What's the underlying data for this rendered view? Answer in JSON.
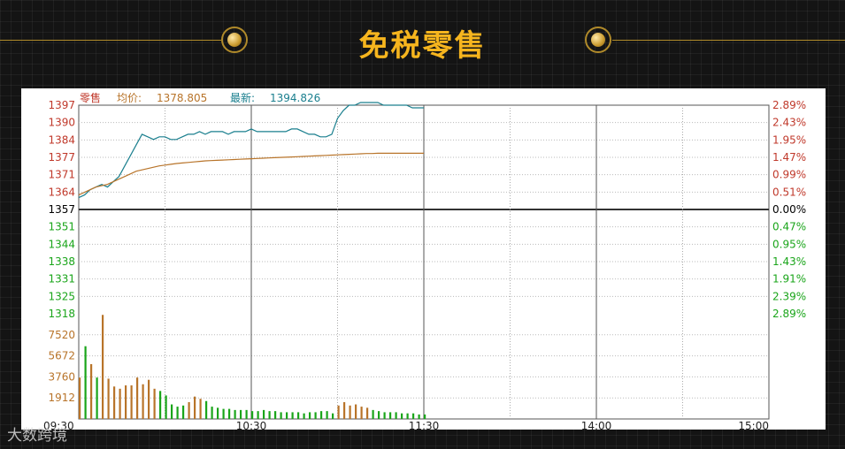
{
  "page": {
    "title": "免税零售",
    "watermark": "大数跨境"
  },
  "chart_data": {
    "type": "line",
    "header": {
      "name": "零售",
      "avg_label": "均价:",
      "avg_value": "1378.805",
      "last_label": "最新:",
      "last_value": "1394.826"
    },
    "price_axis": {
      "ylim": [
        1318,
        1397
      ],
      "base": 1357,
      "ticks_left": [
        "1397",
        "1390",
        "1384",
        "1377",
        "1371",
        "1364",
        "1357",
        "1351",
        "1344",
        "1338",
        "1331",
        "1325",
        "1318"
      ],
      "ticks_right": [
        "2.89%",
        "2.43%",
        "1.95%",
        "1.47%",
        "0.99%",
        "0.51%",
        "0.00%",
        "0.47%",
        "0.95%",
        "1.43%",
        "1.91%",
        "2.39%",
        "2.89%"
      ]
    },
    "volume_axis": {
      "ylim": [
        0,
        9400
      ],
      "ticks": [
        "7520",
        "5672",
        "3760",
        "1912"
      ]
    },
    "x_ticks": [
      "09:30",
      "10:30",
      "11:30",
      "14:00",
      "15:00"
    ],
    "total_minutes": 240,
    "colors": {
      "price": "#1a7f8e",
      "avg": "#b8742a",
      "up": "#c0392b",
      "down": "#1aa51a",
      "base": "#000000",
      "vol_up": "#b8742a",
      "vol_down": "#1aa51a"
    },
    "series": [
      {
        "name": "最新",
        "x": [
          0,
          2,
          4,
          6,
          8,
          10,
          12,
          14,
          16,
          18,
          20,
          22,
          24,
          26,
          28,
          30,
          32,
          34,
          36,
          38,
          40,
          42,
          44,
          46,
          48,
          50,
          52,
          54,
          56,
          58,
          60,
          62,
          64,
          66,
          68,
          70,
          72,
          74,
          76,
          78,
          80,
          82,
          84,
          86,
          88,
          90,
          92,
          94,
          96,
          98,
          100,
          102,
          104,
          106,
          108,
          110,
          112,
          114,
          116,
          118,
          120
        ],
        "values": [
          1362,
          1363,
          1365,
          1366,
          1367,
          1366,
          1368,
          1370,
          1374,
          1378,
          1382,
          1386,
          1385,
          1384,
          1385,
          1385,
          1384,
          1384,
          1385,
          1386,
          1386,
          1387,
          1386,
          1387,
          1387,
          1387,
          1386,
          1387,
          1387,
          1387,
          1388,
          1387,
          1387,
          1387,
          1387,
          1387,
          1387,
          1388,
          1388,
          1387,
          1386,
          1386,
          1385,
          1385,
          1386,
          1392,
          1395,
          1397,
          1397,
          1398,
          1398,
          1398,
          1398,
          1397,
          1397,
          1397,
          1397,
          1397,
          1396,
          1396,
          1396
        ]
      },
      {
        "name": "均价",
        "x": [
          0,
          2,
          4,
          6,
          8,
          10,
          12,
          14,
          16,
          18,
          20,
          22,
          24,
          26,
          28,
          30,
          32,
          34,
          36,
          38,
          40,
          42,
          44,
          46,
          48,
          50,
          52,
          54,
          56,
          58,
          60,
          62,
          64,
          66,
          68,
          70,
          72,
          74,
          76,
          78,
          80,
          82,
          84,
          86,
          88,
          90,
          92,
          94,
          96,
          98,
          100,
          102,
          104,
          106,
          108,
          110,
          112,
          114,
          116,
          118,
          120
        ],
        "values": [
          1363,
          1364,
          1365,
          1366,
          1366.5,
          1367,
          1368,
          1369,
          1370,
          1371,
          1372,
          1372.5,
          1373,
          1373.5,
          1374,
          1374.3,
          1374.6,
          1374.9,
          1375.1,
          1375.3,
          1375.5,
          1375.7,
          1375.9,
          1376,
          1376.1,
          1376.2,
          1376.3,
          1376.4,
          1376.5,
          1376.6,
          1376.7,
          1376.8,
          1376.9,
          1377,
          1377.1,
          1377.2,
          1377.3,
          1377.4,
          1377.5,
          1377.6,
          1377.7,
          1377.8,
          1377.9,
          1378,
          1378.1,
          1378.2,
          1378.3,
          1378.4,
          1378.5,
          1378.6,
          1378.7,
          1378.7,
          1378.8,
          1378.8,
          1378.8,
          1378.8,
          1378.8,
          1378.8,
          1378.8,
          1378.8,
          1378.8
        ]
      }
    ],
    "volume": {
      "x": [
        0,
        2,
        4,
        6,
        8,
        10,
        12,
        14,
        16,
        18,
        20,
        22,
        24,
        26,
        28,
        30,
        32,
        34,
        36,
        38,
        40,
        42,
        44,
        46,
        48,
        50,
        52,
        54,
        56,
        58,
        60,
        62,
        64,
        66,
        68,
        70,
        72,
        74,
        76,
        78,
        80,
        82,
        84,
        86,
        88,
        90,
        92,
        94,
        96,
        98,
        100,
        102,
        104,
        106,
        108,
        110,
        112,
        114,
        116,
        118,
        120
      ],
      "values": [
        3700,
        6500,
        4900,
        3700,
        9300,
        3600,
        2900,
        2700,
        3000,
        3000,
        3700,
        3100,
        3500,
        2700,
        2500,
        2100,
        1300,
        1100,
        1200,
        1500,
        2000,
        1800,
        1600,
        1100,
        1000,
        900,
        900,
        800,
        800,
        800,
        700,
        700,
        800,
        700,
        700,
        600,
        600,
        600,
        600,
        500,
        600,
        600,
        700,
        700,
        500,
        1200,
        1500,
        1200,
        1300,
        1100,
        1000,
        800,
        700,
        600,
        600,
        600,
        500,
        500,
        500,
        400,
        400
      ],
      "direction": [
        "up",
        "down",
        "up",
        "down",
        "up",
        "up",
        "up",
        "up",
        "up",
        "up",
        "up",
        "up",
        "up",
        "up",
        "down",
        "down",
        "down",
        "down",
        "down",
        "up",
        "up",
        "up",
        "down",
        "down",
        "down",
        "down",
        "down",
        "down",
        "down",
        "down",
        "down",
        "down",
        "down",
        "down",
        "down",
        "down",
        "down",
        "down",
        "down",
        "down",
        "down",
        "down",
        "down",
        "down",
        "down",
        "up",
        "up",
        "up",
        "up",
        "up",
        "up",
        "down",
        "down",
        "down",
        "down",
        "down",
        "down",
        "down",
        "down",
        "down",
        "down"
      ]
    }
  }
}
